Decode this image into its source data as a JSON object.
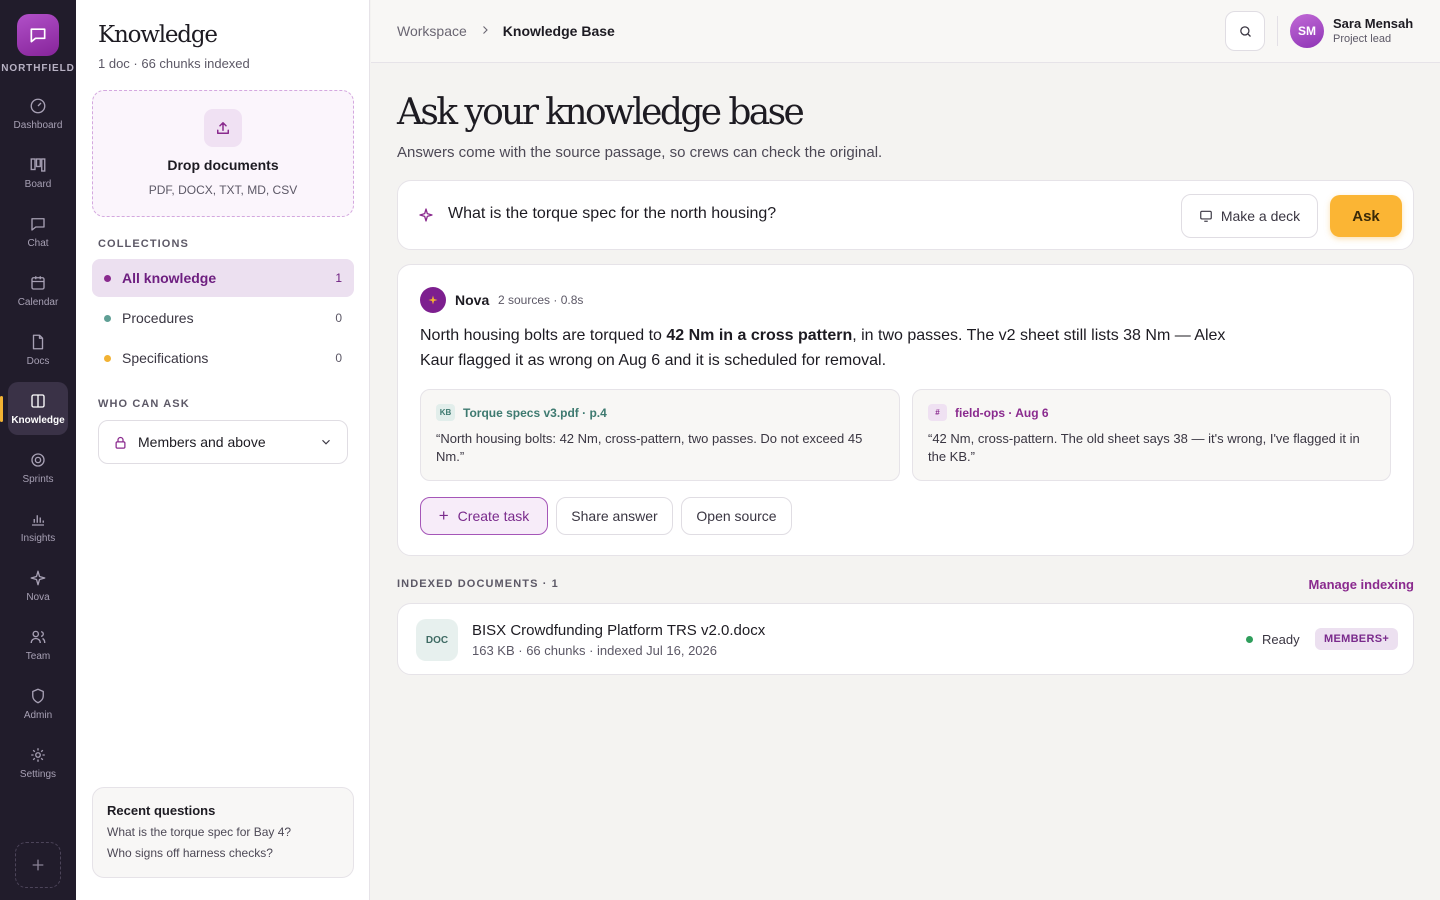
{
  "rail": {
    "brand": "NORTHFIELD",
    "items": [
      {
        "label": "Dashboard",
        "icon": "dashboard-icon"
      },
      {
        "label": "Board",
        "icon": "board-icon"
      },
      {
        "label": "Chat",
        "icon": "chat-icon"
      },
      {
        "label": "Calendar",
        "icon": "calendar-icon"
      },
      {
        "label": "Docs",
        "icon": "docs-icon"
      },
      {
        "label": "Knowledge",
        "icon": "knowledge-icon",
        "active": true
      },
      {
        "label": "Sprints",
        "icon": "sprints-icon"
      },
      {
        "label": "Insights",
        "icon": "insights-icon"
      },
      {
        "label": "Nova",
        "icon": "nova-icon"
      },
      {
        "label": "Team",
        "icon": "team-icon"
      },
      {
        "label": "Admin",
        "icon": "admin-icon"
      },
      {
        "label": "Settings",
        "icon": "settings-icon"
      }
    ]
  },
  "sidebar": {
    "title": "Knowledge",
    "subtitle": "1 doc · 66 chunks indexed",
    "drop": {
      "title": "Drop documents",
      "formats": "PDF, DOCX, TXT, MD, CSV"
    },
    "collections_label": "COLLECTIONS",
    "collections": [
      {
        "label": "All knowledge",
        "count": "1",
        "color": "#8a2a8e"
      },
      {
        "label": "Procedures",
        "count": "0",
        "color": "#5f9f95"
      },
      {
        "label": "Specifications",
        "count": "0",
        "color": "#f2b233"
      }
    ],
    "access_label": "WHO CAN ASK",
    "access_value": "Members and above",
    "recent": {
      "title": "Recent questions",
      "questions": [
        "What is the torque spec for Bay 4?",
        "Who signs off harness checks?"
      ]
    }
  },
  "header": {
    "breadcrumb": [
      "Workspace",
      "Knowledge Base"
    ],
    "user": {
      "initials": "SM",
      "name": "Sara Mensah",
      "role": "Project lead"
    }
  },
  "main": {
    "title": "Ask your knowledge base",
    "subtitle": "Answers come with the source passage, so crews can check the original.",
    "question": "What is the torque spec for the north housing?",
    "make_deck_label": "Make a deck",
    "ask_label": "Ask",
    "answer": {
      "author": "Nova",
      "meta": "2 sources · 0.8s",
      "text_before": "North housing bolts are torqued to ",
      "text_bold": "42 Nm in a cross pattern",
      "text_after": ", in two passes. The v2 sheet still lists 38 Nm — Alex Kaur flagged it as wrong on Aug 6 and it is scheduled for removal.",
      "sources": [
        {
          "badge": "KB",
          "title": "Torque specs v3.pdf · p.4",
          "quote": "“North housing bolts: 42 Nm, cross-pattern, two passes. Do not exceed 45 Nm.”",
          "color": "#3e7a70",
          "badge_bg": "#e2eeeb"
        },
        {
          "badge": "#",
          "title": "field-ops · Aug 6",
          "quote": "“42 Nm, cross-pattern. The old sheet says 38 — it's wrong, I've flagged it in the KB.”",
          "color": "#8a2a8e",
          "badge_bg": "#efe1f2"
        }
      ],
      "actions": [
        "Create task",
        "Share answer",
        "Open source"
      ]
    },
    "indexed_label": "INDEXED DOCUMENTS · 1",
    "manage_label": "Manage indexing",
    "documents": [
      {
        "icon": "DOC",
        "name": "BISX Crowdfunding Platform TRS v2.0.docx",
        "meta": "163 KB · 66 chunks · indexed Jul 16, 2026",
        "status": "Ready",
        "badge": "MEMBERS+"
      }
    ]
  }
}
